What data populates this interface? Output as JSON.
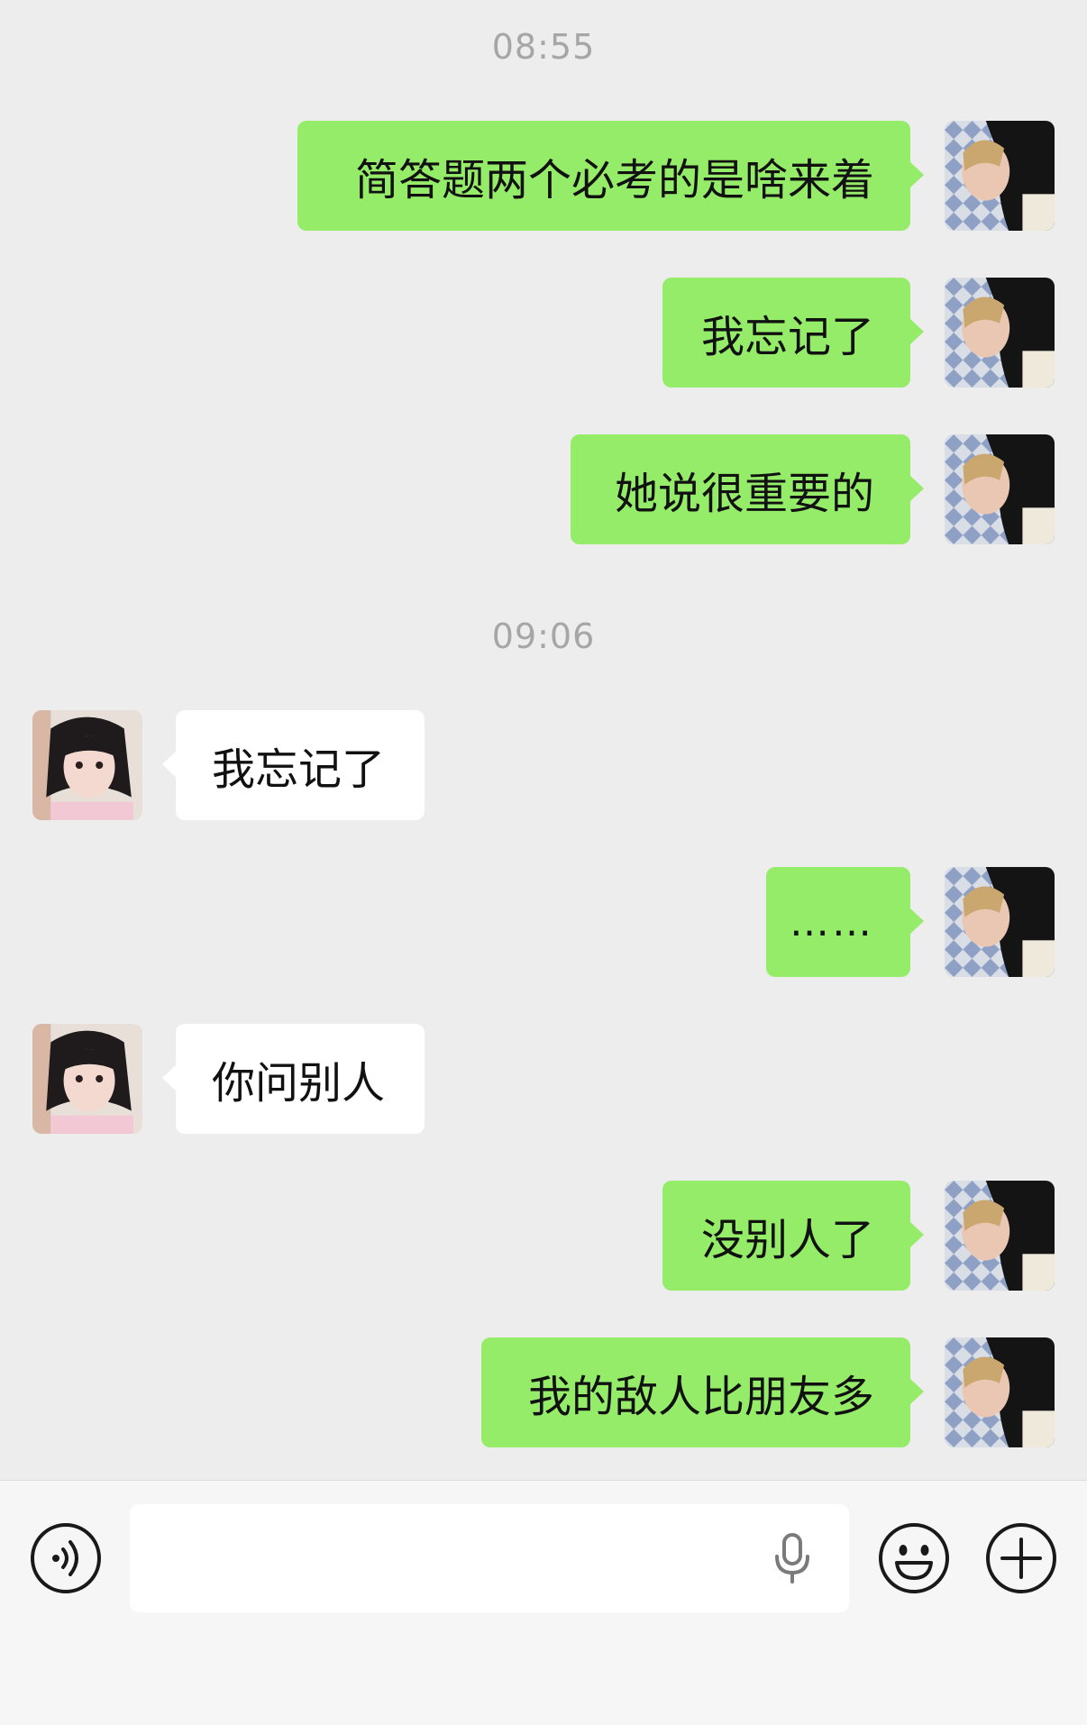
{
  "messages": [
    {
      "kind": "timestamp",
      "text": "08:55"
    },
    {
      "kind": "msg",
      "from": "me",
      "text": "简答题两个必考的是啥来着"
    },
    {
      "kind": "msg",
      "from": "me",
      "text": "我忘记了"
    },
    {
      "kind": "msg",
      "from": "me",
      "text": "她说很重要的"
    },
    {
      "kind": "timestamp",
      "text": "09:06"
    },
    {
      "kind": "msg",
      "from": "them",
      "text": "我忘记了"
    },
    {
      "kind": "msg",
      "from": "me",
      "text": "……"
    },
    {
      "kind": "msg",
      "from": "them",
      "text": "你问别人"
    },
    {
      "kind": "msg",
      "from": "me",
      "text": "没别人了"
    },
    {
      "kind": "msg",
      "from": "me",
      "text": "我的敌人比朋友多"
    }
  ],
  "input_bar": {
    "text_value": "",
    "icons": [
      "voice-toggle-icon",
      "microphone-icon",
      "emoji-icon",
      "plus-icon"
    ]
  },
  "colors": {
    "background": "#ededed",
    "my_bubble": "#95ec69",
    "their_bubble": "#ffffff",
    "timestamp": "#a6a6a6",
    "input_bar": "#f6f6f6"
  }
}
